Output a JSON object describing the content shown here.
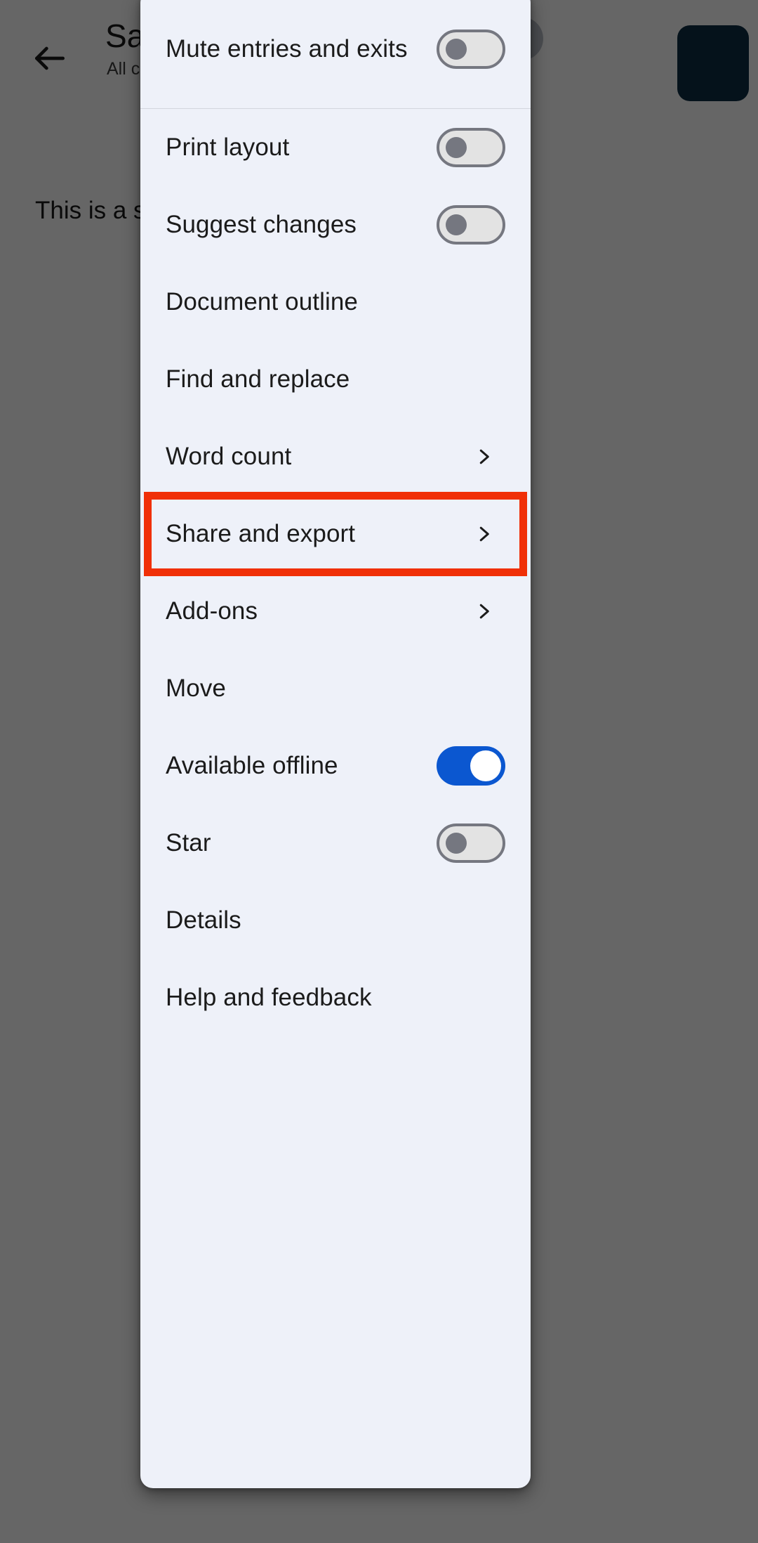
{
  "background": {
    "back_icon": "arrow-left-icon",
    "doc_title": "Sample D",
    "doc_subtitle": "All ch",
    "doc_body_text": "This is a sa",
    "edit_button": "edit-fab",
    "avatar": "avatar"
  },
  "colors": {
    "menu_background": "#eef1f9",
    "toggle_on": "#0b57d0",
    "toggle_off_track": "#e3e3e3",
    "toggle_off_outline": "#757780",
    "highlight_border": "#f03008",
    "scrim": "rgba(0,0,0,0.6)",
    "fab": "#0d2f44"
  },
  "menu": {
    "items": [
      {
        "label": "Mute entries and exits",
        "control": "toggle",
        "toggle_state": "off",
        "two_line": true,
        "divider_after": true,
        "highlighted": false
      },
      {
        "label": "Print layout",
        "control": "toggle",
        "toggle_state": "off",
        "two_line": false,
        "divider_after": false,
        "highlighted": false
      },
      {
        "label": "Suggest changes",
        "control": "toggle",
        "toggle_state": "off",
        "two_line": false,
        "divider_after": false,
        "highlighted": false
      },
      {
        "label": "Document outline",
        "control": "none",
        "toggle_state": "",
        "two_line": false,
        "divider_after": false,
        "highlighted": false
      },
      {
        "label": "Find and replace",
        "control": "none",
        "toggle_state": "",
        "two_line": false,
        "divider_after": false,
        "highlighted": false
      },
      {
        "label": "Word count",
        "control": "chevron",
        "toggle_state": "",
        "two_line": false,
        "divider_after": false,
        "highlighted": false
      },
      {
        "label": "Share and export",
        "control": "chevron",
        "toggle_state": "",
        "two_line": false,
        "divider_after": false,
        "highlighted": true
      },
      {
        "label": "Add-ons",
        "control": "chevron",
        "toggle_state": "",
        "two_line": false,
        "divider_after": false,
        "highlighted": false
      },
      {
        "label": "Move",
        "control": "none",
        "toggle_state": "",
        "two_line": false,
        "divider_after": false,
        "highlighted": false
      },
      {
        "label": "Available offline",
        "control": "toggle",
        "toggle_state": "on",
        "two_line": false,
        "divider_after": false,
        "highlighted": false
      },
      {
        "label": "Star",
        "control": "toggle",
        "toggle_state": "off",
        "two_line": false,
        "divider_after": false,
        "highlighted": false
      },
      {
        "label": "Details",
        "control": "none",
        "toggle_state": "",
        "two_line": false,
        "divider_after": false,
        "highlighted": false
      },
      {
        "label": "Help and feedback",
        "control": "none",
        "toggle_state": "",
        "two_line": false,
        "divider_after": false,
        "highlighted": false
      }
    ]
  }
}
